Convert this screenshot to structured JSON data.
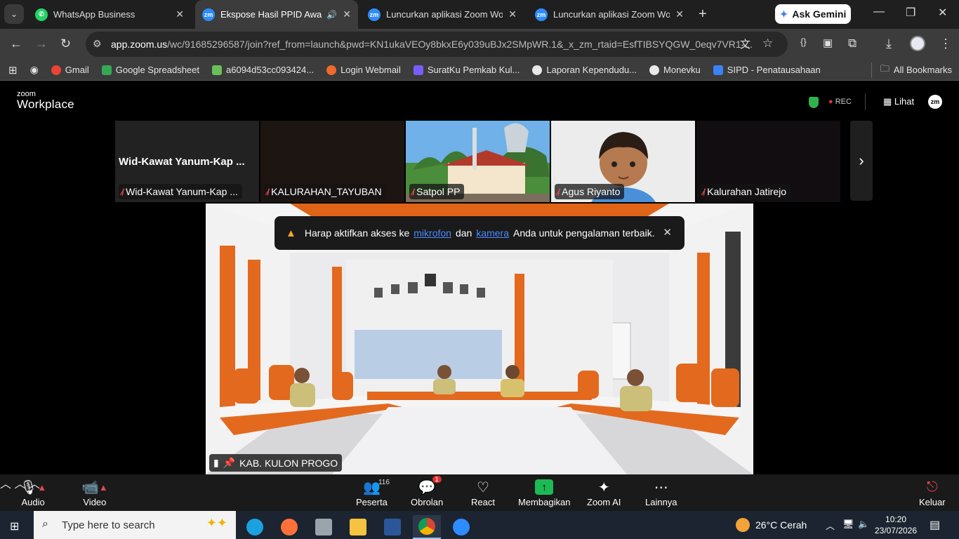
{
  "browser": {
    "tabs": [
      {
        "title": "WhatsApp Business",
        "favicon_color": "#25d366",
        "active": false
      },
      {
        "title": "Ekspose Hasil PPID Award",
        "favicon_color": "#2d8cff",
        "favicon_text": "zm",
        "active": true,
        "audio": true
      },
      {
        "title": "Luncurkan aplikasi Zoom Workp",
        "favicon_color": "#2d8cff",
        "favicon_text": "zm",
        "active": false
      },
      {
        "title": "Luncurkan aplikasi Zoom Workp",
        "favicon_color": "#2d8cff",
        "favicon_text": "zm",
        "active": false
      }
    ],
    "gemini_label": "Ask Gemini",
    "url_host": "app.zoom.us",
    "url_path": "/wc/91685296587/join?ref_from=launch&pwd=KN1ukaVEOy8bkxE6y039uBJx2SMpWR.1&_x_zm_rtaid=EsfTIBSYQGW_0eqv7VR1-...",
    "bookmarks": [
      {
        "label": "Gmail",
        "color": "#ea4335"
      },
      {
        "label": "Google Spreadsheet",
        "color": "#34a853"
      },
      {
        "label": "a6094d53cc093424...",
        "color": "#6bbf59"
      },
      {
        "label": "Login Webmail",
        "color": "#f06a2a"
      },
      {
        "label": "SuratKu Pemkab Kul...",
        "color": "#7b5cff"
      },
      {
        "label": "Laporan Kependudu...",
        "color": "#e8e8e8"
      },
      {
        "label": "Monevku",
        "color": "#e8e8e8"
      },
      {
        "label": "SIPD - Penatausahaan",
        "color": "#3b82f6"
      }
    ],
    "all_bookmarks": "All Bookmarks"
  },
  "zoom": {
    "logo_small": "zoom",
    "logo_big": "Workplace",
    "rec": "REC",
    "view_label": "Lihat",
    "avatar_text": "zm",
    "participants": [
      {
        "name": "Wid-Kawat Yanum-Kap ...",
        "big_name": "Wid-Kawat Yanum-Kap ...",
        "muted": true,
        "type": "name"
      },
      {
        "name": "KALURAHAN_TAYUBAN",
        "muted": true,
        "type": "dark"
      },
      {
        "name": "Satpol PP",
        "muted": true,
        "type": "building"
      },
      {
        "name": "Agus Riyanto",
        "muted": true,
        "type": "avatar"
      },
      {
        "name": "Kalurahan Jatirejo",
        "muted": true,
        "type": "dark2"
      }
    ],
    "main_speaker": "KAB. KULON PROGO",
    "toast": {
      "before": "Harap aktifkan akses ke",
      "link1": "mikrofon",
      "middle": "dan",
      "link2": "kamera",
      "after": "Anda untuk pengalaman terbaik."
    },
    "controls": {
      "audio": "Audio",
      "video": "Video",
      "participants": "Peserta",
      "participants_count": "116",
      "chat": "Obrolan",
      "chat_badge": "1",
      "react": "React",
      "share": "Membagikan",
      "ai": "Zoom AI",
      "more": "Lainnya",
      "leave": "Keluar"
    }
  },
  "taskbar": {
    "search_placeholder": "Type here to search",
    "weather": "26°C  Cerah",
    "time": "10:20",
    "date": "23/07/2026"
  }
}
